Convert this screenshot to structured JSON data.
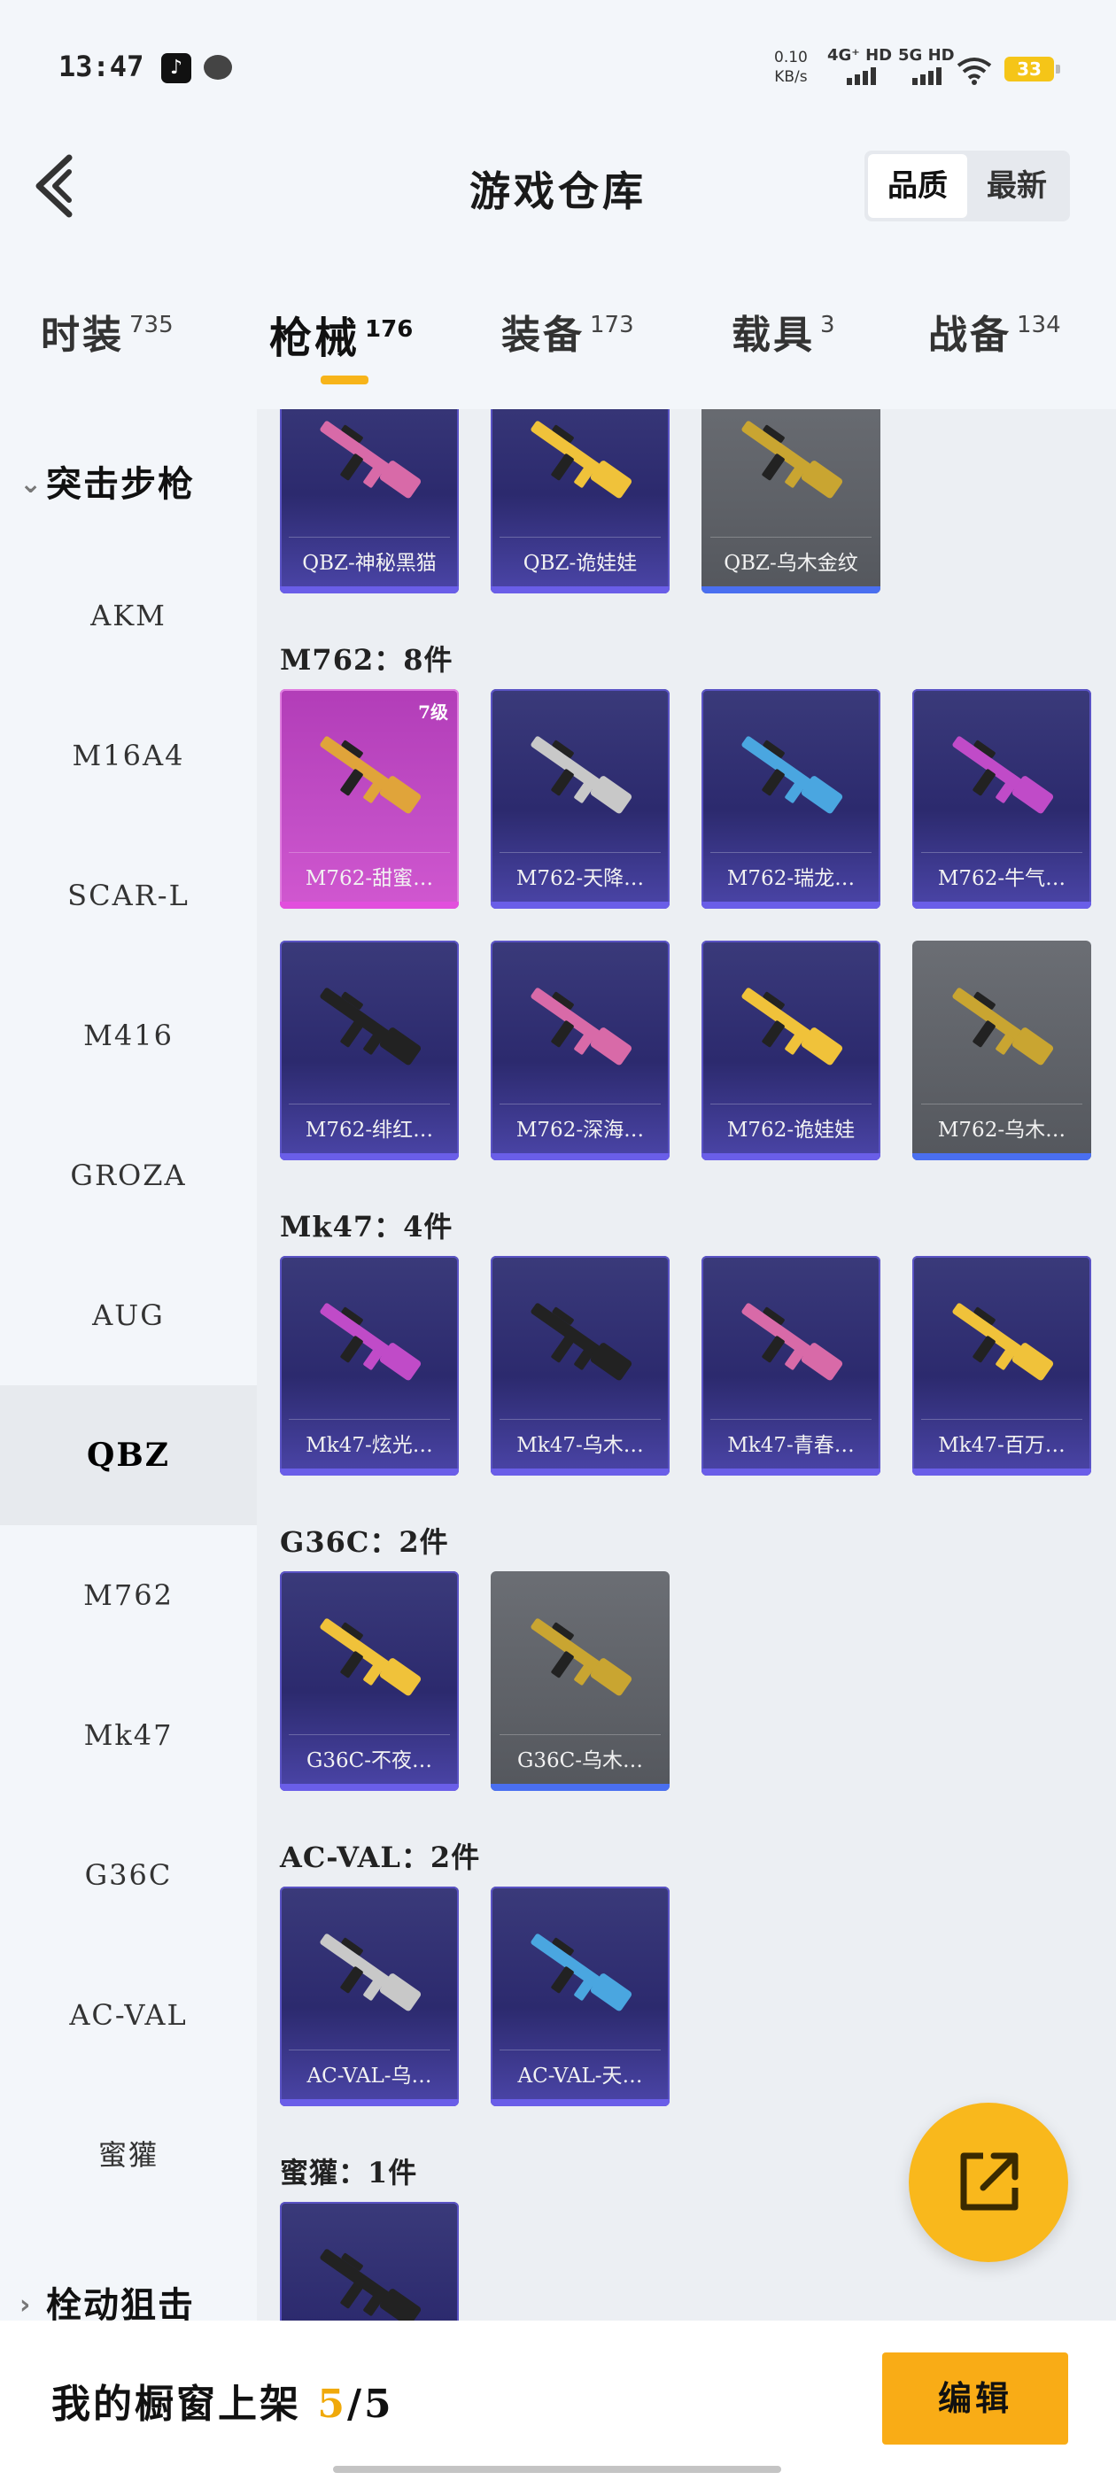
{
  "status_bar": {
    "time": "13:47",
    "app_icons": [
      "tiktok-icon",
      "message-icon"
    ],
    "net_speed_value": "0.10",
    "net_speed_unit": "KB/s",
    "net1": "4G⁺ HD",
    "net2": "5G HD",
    "battery": "33"
  },
  "header": {
    "title": "游戏仓库",
    "back_icon": "chevron-left-icon",
    "sort_options": [
      "品质",
      "最新"
    ],
    "sort_selected": "品质"
  },
  "tabs": [
    {
      "label": "时装",
      "count": "735"
    },
    {
      "label": "枪械",
      "count": "176"
    },
    {
      "label": "装备",
      "count": "173"
    },
    {
      "label": "载具",
      "count": "3"
    },
    {
      "label": "战备",
      "count": "134"
    }
  ],
  "active_tab": "枪械",
  "sidebar": {
    "group_open": "突击步枪",
    "items": [
      "AKM",
      "M16A4",
      "SCAR-L",
      "M416",
      "GROZA",
      "AUG",
      "QBZ",
      "M762",
      "Mk47",
      "G36C",
      "AC-VAL",
      "蜜獾"
    ],
    "active_item": "QBZ",
    "group_closed": "栓动狙击"
  },
  "sections": [
    {
      "title": "",
      "items": [
        {
          "label": "QBZ-神秘黑猫",
          "style": "purple"
        },
        {
          "label": "QBZ-诡娃娃",
          "style": "purple"
        },
        {
          "label": "QBZ-乌木金纹",
          "style": "grey"
        }
      ]
    },
    {
      "title": "M762：8件",
      "items": [
        {
          "label": "M762-甜蜜…",
          "style": "pink",
          "badge": "7级"
        },
        {
          "label": "M762-天降…",
          "style": "purple"
        },
        {
          "label": "M762-瑞龙…",
          "style": "purple"
        },
        {
          "label": "M762-牛气…",
          "style": "purple"
        },
        {
          "label": "M762-绯红…",
          "style": "purple"
        },
        {
          "label": "M762-深海…",
          "style": "purple"
        },
        {
          "label": "M762-诡娃娃",
          "style": "purple"
        },
        {
          "label": "M762-乌木…",
          "style": "grey"
        }
      ]
    },
    {
      "title": "Mk47：4件",
      "items": [
        {
          "label": "Mk47-炫光…",
          "style": "purple"
        },
        {
          "label": "Mk47-乌木…",
          "style": "purple"
        },
        {
          "label": "Mk47-青春…",
          "style": "purple"
        },
        {
          "label": "Mk47-百万…",
          "style": "purple"
        }
      ]
    },
    {
      "title": "G36C：2件",
      "items": [
        {
          "label": "G36C-不夜…",
          "style": "purple"
        },
        {
          "label": "G36C-乌木…",
          "style": "grey"
        }
      ]
    },
    {
      "title": "AC-VAL：2件",
      "items": [
        {
          "label": "AC-VAL-乌…",
          "style": "purple"
        },
        {
          "label": "AC-VAL-天…",
          "style": "purple"
        }
      ]
    },
    {
      "title": "蜜獾：1件",
      "items": [
        {
          "label": "",
          "style": "purple"
        }
      ]
    }
  ],
  "fab": {
    "icon": "share-external-icon"
  },
  "bottom_bar": {
    "label": "我的橱窗上架",
    "count": "5",
    "separator": "/",
    "total": "5",
    "edit_label": "编辑"
  }
}
